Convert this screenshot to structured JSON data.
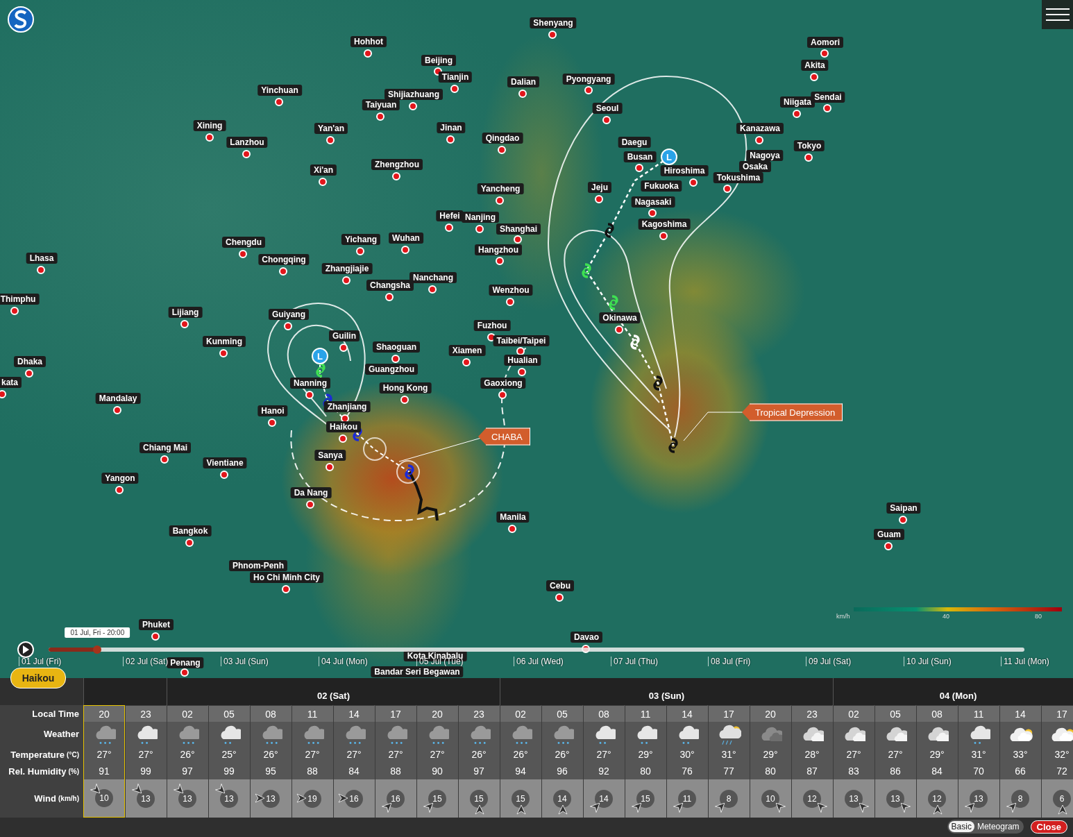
{
  "map": {
    "cities": [
      {
        "name": "Hohhot"
      },
      {
        "name": "Shenyang"
      },
      {
        "name": "Beijing"
      },
      {
        "name": "Tianjin"
      },
      {
        "name": "Dalian"
      },
      {
        "name": "Pyongyang"
      },
      {
        "name": "Aomori"
      },
      {
        "name": "Akita"
      },
      {
        "name": "Niigata"
      },
      {
        "name": "Sendai"
      },
      {
        "name": "Yinchuan"
      },
      {
        "name": "Shijiazhuang"
      },
      {
        "name": "Taiyuan"
      },
      {
        "name": "Seoul"
      },
      {
        "name": "Xining"
      },
      {
        "name": "Lanzhou"
      },
      {
        "name": "Yan'an"
      },
      {
        "name": "Jinan"
      },
      {
        "name": "Qingdao"
      },
      {
        "name": "Kanazawa"
      },
      {
        "name": "Tokyo"
      },
      {
        "name": "Daegu"
      },
      {
        "name": "Busan"
      },
      {
        "name": "Nagoya"
      },
      {
        "name": "Hiroshima"
      },
      {
        "name": "Osaka"
      },
      {
        "name": "Tokushima"
      },
      {
        "name": "Xi'an"
      },
      {
        "name": "Zhengzhou"
      },
      {
        "name": "Yancheng"
      },
      {
        "name": "Jeju"
      },
      {
        "name": "Fukuoka"
      },
      {
        "name": "Nagasaki"
      },
      {
        "name": "Kagoshima"
      },
      {
        "name": "Hefei"
      },
      {
        "name": "Nanjing"
      },
      {
        "name": "Shanghai"
      },
      {
        "name": "Hangzhou"
      },
      {
        "name": "Chengdu"
      },
      {
        "name": "Yichang"
      },
      {
        "name": "Wuhan"
      },
      {
        "name": "Chongqing"
      },
      {
        "name": "Zhangjiajie"
      },
      {
        "name": "Nanchang"
      },
      {
        "name": "Changsha"
      },
      {
        "name": "Wenzhou"
      },
      {
        "name": "Lhasa"
      },
      {
        "name": "Thimphu"
      },
      {
        "name": "Lijiang"
      },
      {
        "name": "Guiyang"
      },
      {
        "name": "Okinawa"
      },
      {
        "name": "Fuzhou"
      },
      {
        "name": "Taibei/Taipei"
      },
      {
        "name": "Guilin"
      },
      {
        "name": "Kunming"
      },
      {
        "name": "Shaoguan"
      },
      {
        "name": "Xiamen"
      },
      {
        "name": "Hualian"
      },
      {
        "name": "Dhaka"
      },
      {
        "name": "Guangzhou"
      },
      {
        "name": "kata"
      },
      {
        "name": "Nanning"
      },
      {
        "name": "Gaoxiong"
      },
      {
        "name": "Hong Kong"
      },
      {
        "name": "Mandalay"
      },
      {
        "name": "Zhanjiang"
      },
      {
        "name": "Hanoi"
      },
      {
        "name": "Haikou"
      },
      {
        "name": "Chiang Mai"
      },
      {
        "name": "Vientiane"
      },
      {
        "name": "Sanya"
      },
      {
        "name": "Yangon"
      },
      {
        "name": "Da Nang"
      },
      {
        "name": "Manila"
      },
      {
        "name": "Saipan"
      },
      {
        "name": "Guam"
      },
      {
        "name": "Bangkok"
      },
      {
        "name": "Phnom-Penh"
      },
      {
        "name": "Ho Chi Minh City"
      },
      {
        "name": "Cebu"
      },
      {
        "name": "Phuket"
      },
      {
        "name": "Davao"
      },
      {
        "name": "Kota Kinabalu"
      },
      {
        "name": "Penang"
      },
      {
        "name": "Bandar Seri Begawan"
      }
    ],
    "low_markers": [
      {
        "label": "L"
      },
      {
        "label": "L"
      }
    ],
    "storm_labels": [
      {
        "label": "CHABA"
      },
      {
        "label": "Tropical Depression"
      }
    ],
    "legend": {
      "unit": "km/h",
      "ticks": [
        "40",
        "80"
      ]
    },
    "timeline": {
      "level": 0.05,
      "tooltip": "01 Jul, Fri - 20:00",
      "days": [
        "01 Jul (Fri)",
        "02 Jul (Sat)",
        "03 Jul (Sun)",
        "04 Jul (Mon)",
        "05 Jul (Tue)",
        "06 Jul (Wed)",
        "07 Jul (Thu)",
        "08 Jul (Fri)",
        "09 Jul (Sat)",
        "10 Jul (Sun)",
        "11 Jul (Mon)"
      ]
    },
    "location_button": "Haikou"
  },
  "forecast": {
    "days": [
      {
        "label": "02 (Sat)"
      },
      {
        "label": "03 (Sun)"
      },
      {
        "label": "04 (Mon)"
      }
    ],
    "row_labels": [
      {
        "label": "Local Time"
      },
      {
        "label": "Weather"
      },
      {
        "label": "Temperature",
        "unit": "(°C)"
      },
      {
        "label": "Rel. Humidity",
        "unit": "(%)"
      },
      {
        "label": "Wind",
        "unit": "(km/h)"
      }
    ],
    "columns": [
      {
        "time": "20",
        "kind": "rain",
        "temp": "27°",
        "humidity": "91",
        "wind": {
          "speed": "10",
          "kind": "se"
        },
        "selected": true
      },
      {
        "time": "23",
        "kind": "drizzle",
        "temp": "27°",
        "humidity": "99",
        "wind": {
          "speed": "13",
          "kind": "se"
        },
        "selected": false
      },
      {
        "time": "02",
        "kind": "rain",
        "temp": "26°",
        "humidity": "97",
        "wind": {
          "speed": "13",
          "kind": "se"
        },
        "selected": false
      },
      {
        "time": "05",
        "kind": "drizzle",
        "temp": "25°",
        "humidity": "99",
        "wind": {
          "speed": "13",
          "kind": "se"
        },
        "selected": false
      },
      {
        "time": "08",
        "kind": "rain",
        "temp": "26°",
        "humidity": "95",
        "wind": {
          "speed": "13",
          "kind": "e"
        },
        "selected": false
      },
      {
        "time": "11",
        "kind": "rain",
        "temp": "27°",
        "humidity": "88",
        "wind": {
          "speed": "19",
          "kind": "e"
        },
        "selected": false
      },
      {
        "time": "14",
        "kind": "rain",
        "temp": "27°",
        "humidity": "84",
        "wind": {
          "speed": "16",
          "kind": "e"
        },
        "selected": false
      },
      {
        "time": "17",
        "kind": "rain",
        "temp": "27°",
        "humidity": "88",
        "wind": {
          "speed": "16",
          "kind": "ne"
        },
        "selected": false
      },
      {
        "time": "20",
        "kind": "rain",
        "temp": "27°",
        "humidity": "90",
        "wind": {
          "speed": "15",
          "kind": "ne"
        },
        "selected": false
      },
      {
        "time": "23",
        "kind": "rain",
        "temp": "26°",
        "humidity": "97",
        "wind": {
          "speed": "15",
          "kind": "n"
        },
        "selected": false
      },
      {
        "time": "02",
        "kind": "rain",
        "temp": "26°",
        "humidity": "94",
        "wind": {
          "speed": "15",
          "kind": "n"
        },
        "selected": false
      },
      {
        "time": "05",
        "kind": "rain",
        "temp": "26°",
        "humidity": "96",
        "wind": {
          "speed": "14",
          "kind": "n"
        },
        "selected": false
      },
      {
        "time": "08",
        "kind": "drizzle",
        "temp": "27°",
        "humidity": "92",
        "wind": {
          "speed": "14",
          "kind": "ne"
        },
        "selected": false
      },
      {
        "time": "11",
        "kind": "drizzle",
        "temp": "29°",
        "humidity": "80",
        "wind": {
          "speed": "15",
          "kind": "ne"
        },
        "selected": false
      },
      {
        "time": "14",
        "kind": "drizzle",
        "temp": "30°",
        "humidity": "76",
        "wind": {
          "speed": "11",
          "kind": "ne"
        },
        "selected": false
      },
      {
        "time": "17",
        "kind": "sunshower",
        "temp": "31°",
        "humidity": "77",
        "wind": {
          "speed": "8",
          "kind": "ne"
        },
        "selected": false
      },
      {
        "time": "20",
        "kind": "overcast",
        "temp": "29°",
        "humidity": "80",
        "wind": {
          "speed": "10",
          "kind": "nw"
        },
        "selected": false
      },
      {
        "time": "23",
        "kind": "cloudy",
        "temp": "28°",
        "humidity": "87",
        "wind": {
          "speed": "12",
          "kind": "nw"
        },
        "selected": false
      },
      {
        "time": "02",
        "kind": "cloudy",
        "temp": "27°",
        "humidity": "83",
        "wind": {
          "speed": "13",
          "kind": "nw"
        },
        "selected": false
      },
      {
        "time": "05",
        "kind": "cloudy",
        "temp": "27°",
        "humidity": "86",
        "wind": {
          "speed": "13",
          "kind": "nw"
        },
        "selected": false
      },
      {
        "time": "08",
        "kind": "cloudy",
        "temp": "29°",
        "humidity": "84",
        "wind": {
          "speed": "12",
          "kind": "n"
        },
        "selected": false
      },
      {
        "time": "11",
        "kind": "drizzle",
        "temp": "31°",
        "humidity": "70",
        "wind": {
          "speed": "13",
          "kind": "ne"
        },
        "selected": false
      },
      {
        "time": "14",
        "kind": "sunny",
        "temp": "33°",
        "humidity": "66",
        "wind": {
          "speed": "8",
          "kind": "ne"
        },
        "selected": false
      },
      {
        "time": "17",
        "kind": "sunny",
        "temp": "32°",
        "humidity": "72",
        "wind": {
          "speed": "6",
          "kind": "n"
        },
        "selected": false
      }
    ]
  },
  "footer": {
    "view_toggle": [
      {
        "label": "Basic",
        "selected": true
      },
      {
        "label": "Meteogram",
        "selected": false
      }
    ],
    "close": "Close"
  }
}
